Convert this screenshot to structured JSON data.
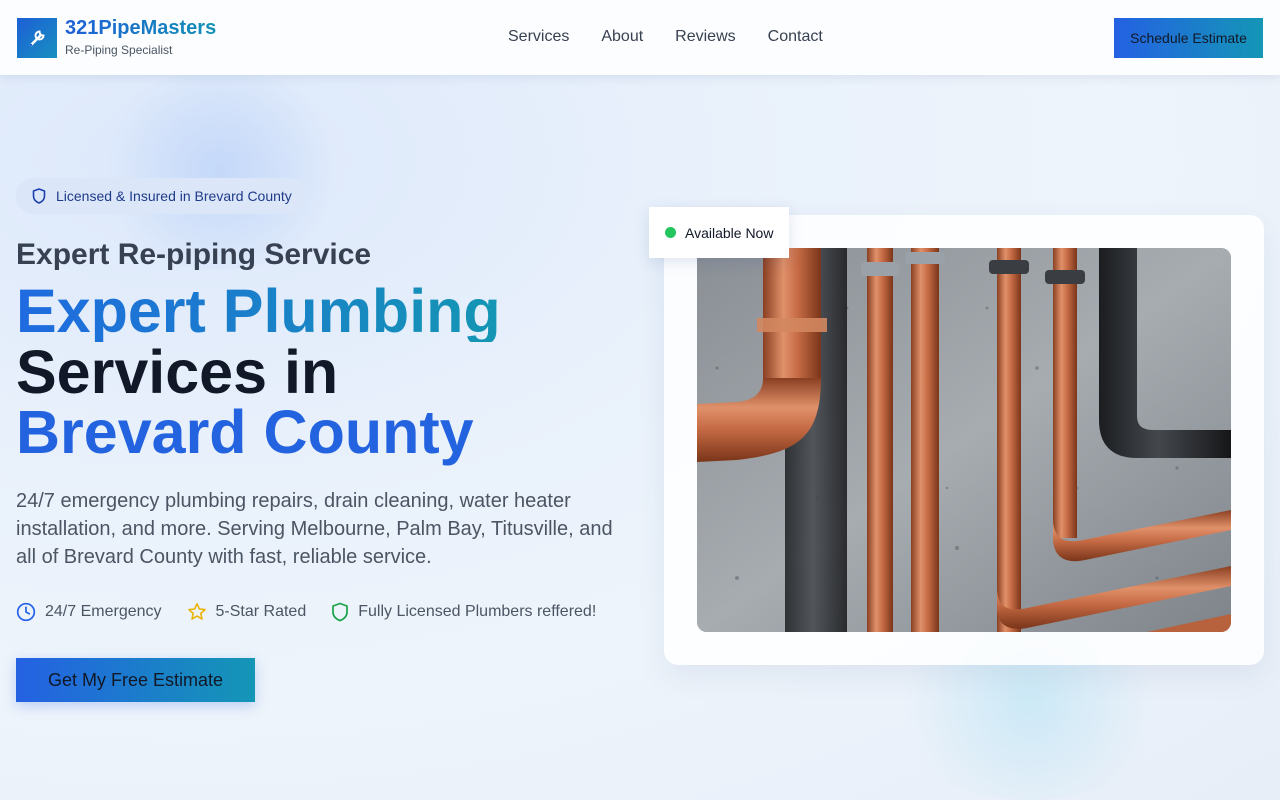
{
  "header": {
    "brand_name": "321PipeMasters",
    "brand_tagline": "Re-Piping Specialist",
    "logo_icon": "wrench-icon",
    "nav": [
      {
        "label": "Services"
      },
      {
        "label": "About"
      },
      {
        "label": "Reviews"
      },
      {
        "label": "Contact"
      }
    ],
    "cta_label": "Schedule Estimate"
  },
  "hero": {
    "badge_icon": "shield-icon",
    "badge_text": "Licensed & Insured in Brevard County",
    "subheading": "Expert Re-piping Service",
    "title_line1": "Expert Plumbing",
    "title_line2": "Services in",
    "title_line3": "Brevard County",
    "description": "24/7 emergency plumbing repairs, drain cleaning, water heater installation, and more. Serving Melbourne, Palm Bay, Titusville, and all of Brevard County with fast, reliable service.",
    "features": [
      {
        "icon": "clock-icon",
        "label": "24/7 Emergency"
      },
      {
        "icon": "star-icon",
        "label": "5-Star Rated"
      },
      {
        "icon": "shield-icon",
        "label": "Fully Licensed Plumbers reffered!"
      }
    ],
    "cta_label": "Get My Free Estimate"
  },
  "image_card": {
    "status_text": "Available Now",
    "status_color": "#22c55e",
    "image_subject": "copper-pipes-photo"
  },
  "colors": {
    "brand_blue": "#2463e0",
    "brand_teal": "#1496b6"
  }
}
